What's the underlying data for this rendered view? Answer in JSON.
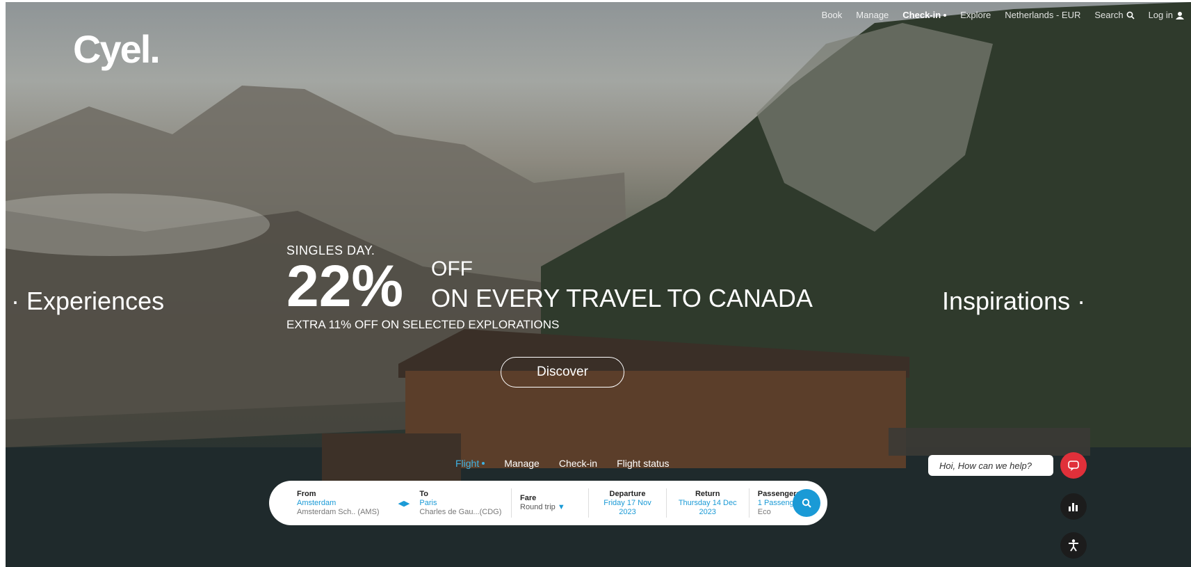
{
  "topnav": {
    "items": [
      "Book",
      "Manage",
      "Check-in",
      "Explore",
      "Netherlands - EUR",
      "Search",
      "Log in"
    ],
    "active": "Check-in"
  },
  "logo": "Cyel.",
  "hero": {
    "left_link": "Experiences",
    "right_link": "Inspirations",
    "eyebrow": "SINGLES DAY.",
    "percent": "22%",
    "off": "OFF",
    "headline": "ON EVERY TRAVEL TO CANADA",
    "extra": "EXTRA 11% OFF ON SELECTED EXPLORATIONS",
    "cta": "Discover"
  },
  "booking_tabs": [
    "Flight",
    "Manage",
    "Check-in",
    "Flight status"
  ],
  "booking": {
    "from": {
      "label": "From",
      "value": "Amsterdam",
      "sub": "Amsterdam Sch.. (AMS)"
    },
    "to": {
      "label": "To",
      "value": "Paris",
      "sub": "Charles de Gau...(CDG)"
    },
    "fare": {
      "label": "Fare",
      "value": "Round trip"
    },
    "departure": {
      "label": "Departure",
      "value": "Friday 17 Nov",
      "value2": "2023"
    },
    "return": {
      "label": "Return",
      "value": "Thursday 14 Dec",
      "value2": "2023"
    },
    "passengers": {
      "label": "Passengers",
      "value": "1 Passenger",
      "sub": "Eco"
    }
  },
  "chat": {
    "prompt": "Hoi, How can we help?"
  },
  "colors": {
    "accent": "#1a9ad6",
    "chat_red": "#e0303a"
  }
}
